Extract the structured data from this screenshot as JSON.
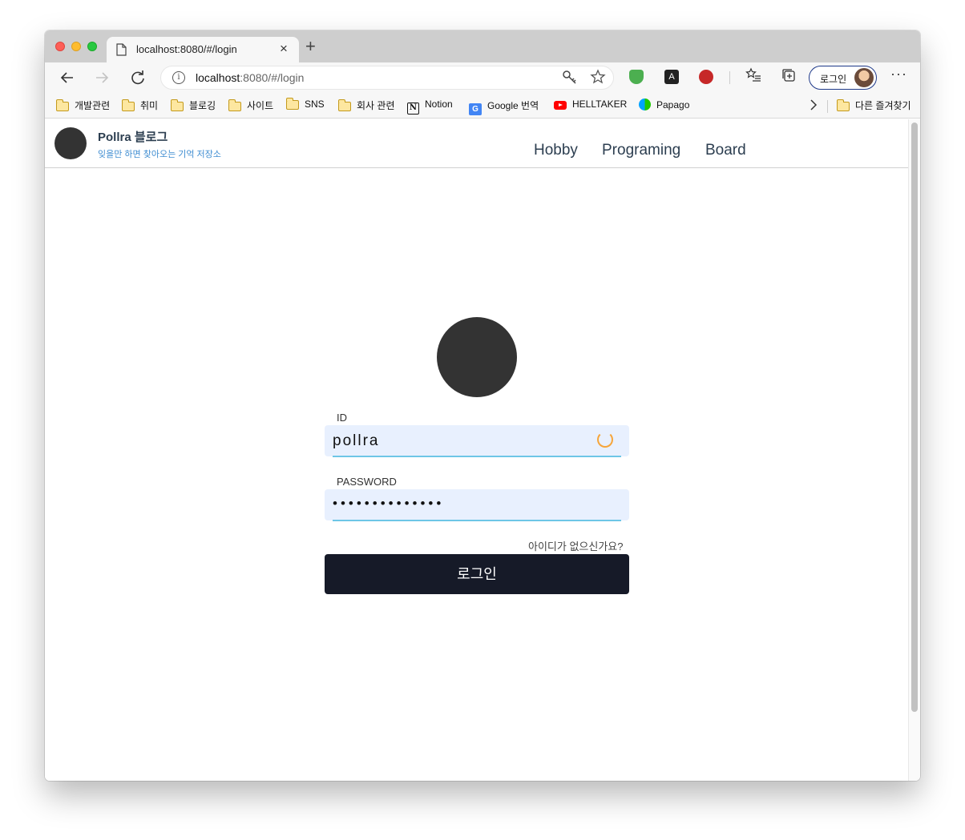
{
  "browser": {
    "tab_title": "localhost:8080/#/login",
    "tab_close": "×",
    "new_tab": "+",
    "address_host": "localhost",
    "address_path": ":8080/#/login",
    "info_icon": "i",
    "profile_label": "로그인",
    "more_label": "···",
    "ext_a": "A",
    "bookmarks": [
      {
        "label": "개발관련",
        "icon": "folder-icon"
      },
      {
        "label": "취미",
        "icon": "folder-icon"
      },
      {
        "label": "블로깅",
        "icon": "folder-icon"
      },
      {
        "label": "사이트",
        "icon": "folder-icon"
      },
      {
        "label": "SNS",
        "icon": "folder-icon"
      },
      {
        "label": "회사 관련",
        "icon": "folder-icon"
      },
      {
        "label": "Notion",
        "icon": "notion-icon"
      },
      {
        "label": "Google 번역",
        "icon": "google-translate-icon"
      },
      {
        "label": "HELLTAKER",
        "icon": "youtube-icon"
      },
      {
        "label": "Papago",
        "icon": "papago-icon"
      }
    ],
    "other_bookmarks": "다른 즐겨찾기",
    "notion_glyph": "N",
    "gtr_glyph": "G"
  },
  "site": {
    "title": "Pollra 블로그",
    "subtitle": "잊을만 하면 찾아오는 기억 저장소",
    "nav": [
      "Hobby",
      "Programing",
      "Board"
    ]
  },
  "login": {
    "id_label": "ID",
    "id_value": "pollra",
    "password_label": "PASSWORD",
    "password_mask": "••••••••••••••",
    "signup_link": "아이디가 없으신가요?",
    "submit_label": "로그인"
  },
  "colors": {
    "field_bg": "#e8f0fe",
    "field_underline": "#6ec6e6",
    "button_bg": "#161a28",
    "accent_link": "#3f8dd1",
    "spinner": "#f6a53a"
  }
}
